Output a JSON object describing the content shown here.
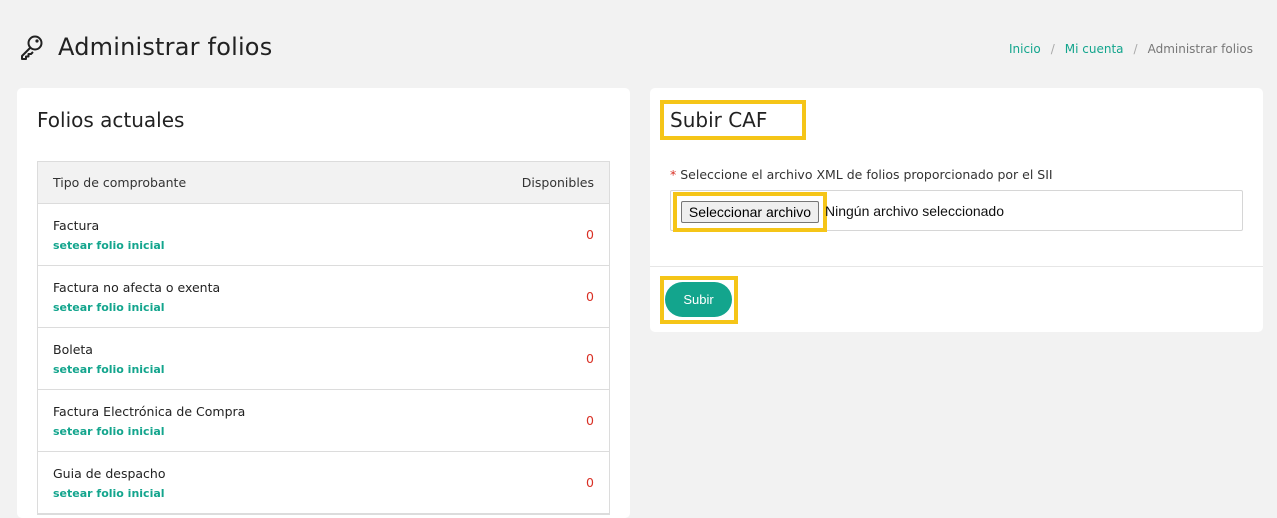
{
  "header": {
    "title": "Administrar folios",
    "icon": "key-icon"
  },
  "breadcrumb": {
    "items": [
      "Inicio",
      "Mi cuenta"
    ],
    "current": "Administrar folios"
  },
  "folios": {
    "title": "Folios actuales",
    "columns": [
      "Tipo de comprobante",
      "Disponibles"
    ],
    "rows": [
      {
        "name": "Factura",
        "link": "setear folio inicial",
        "count": "0"
      },
      {
        "name": "Factura no afecta o exenta",
        "link": "setear folio inicial",
        "count": "0"
      },
      {
        "name": "Boleta",
        "link": "setear folio inicial",
        "count": "0"
      },
      {
        "name": "Factura Electrónica de Compra",
        "link": "setear folio inicial",
        "count": "0"
      },
      {
        "name": "Guia de despacho",
        "link": "setear folio inicial",
        "count": "0"
      }
    ]
  },
  "upload": {
    "title": "Subir CAF",
    "required_mark": "*",
    "label": "Seleccione el archivo XML de folios proporcionado por el SII",
    "file_button": "Seleccionar archivo",
    "file_status": "Ningún archivo seleccionado",
    "submit": "Subir"
  },
  "colors": {
    "accent": "#13a58d",
    "danger": "#d93025",
    "highlight": "#f5c518",
    "background": "#f2f2f2"
  }
}
